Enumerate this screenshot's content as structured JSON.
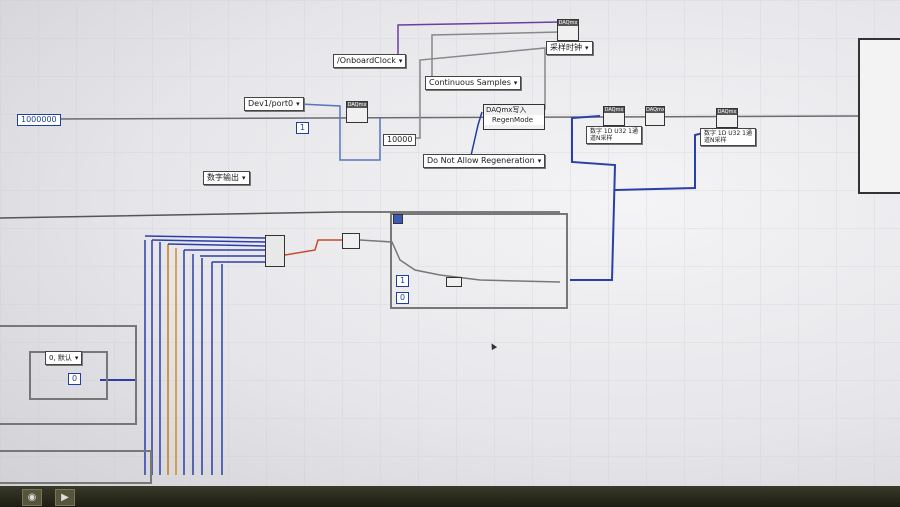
{
  "block_diagram": {
    "constants": {
      "onboard_clock": "/OnboardClock",
      "continuous_samples": "Continuous Samples",
      "do_not_allow_regen": "Do Not Allow Regeneration",
      "dev_channel": "Dev1/port0",
      "sample_clock_label": "采样时钟",
      "number_label": "数字输出"
    },
    "numerics": {
      "rate": "1000000",
      "samples": "10000",
      "small_const_a": "1",
      "small_const_b": "0"
    },
    "nodes": {
      "daqmx_write_1": "数字 1D U32 1通道N采样",
      "daqmx_write_2": "数字 1D U32 1通道N采样",
      "property_node": "DAQmx写入",
      "regen_mode": "RegenMode",
      "timing_header": "DAQmx"
    },
    "loop_labels": {
      "case_selector": "0, 默认"
    }
  },
  "taskbar": {
    "start_icon": "start-icon",
    "run_icon": "run-arrow-icon"
  }
}
